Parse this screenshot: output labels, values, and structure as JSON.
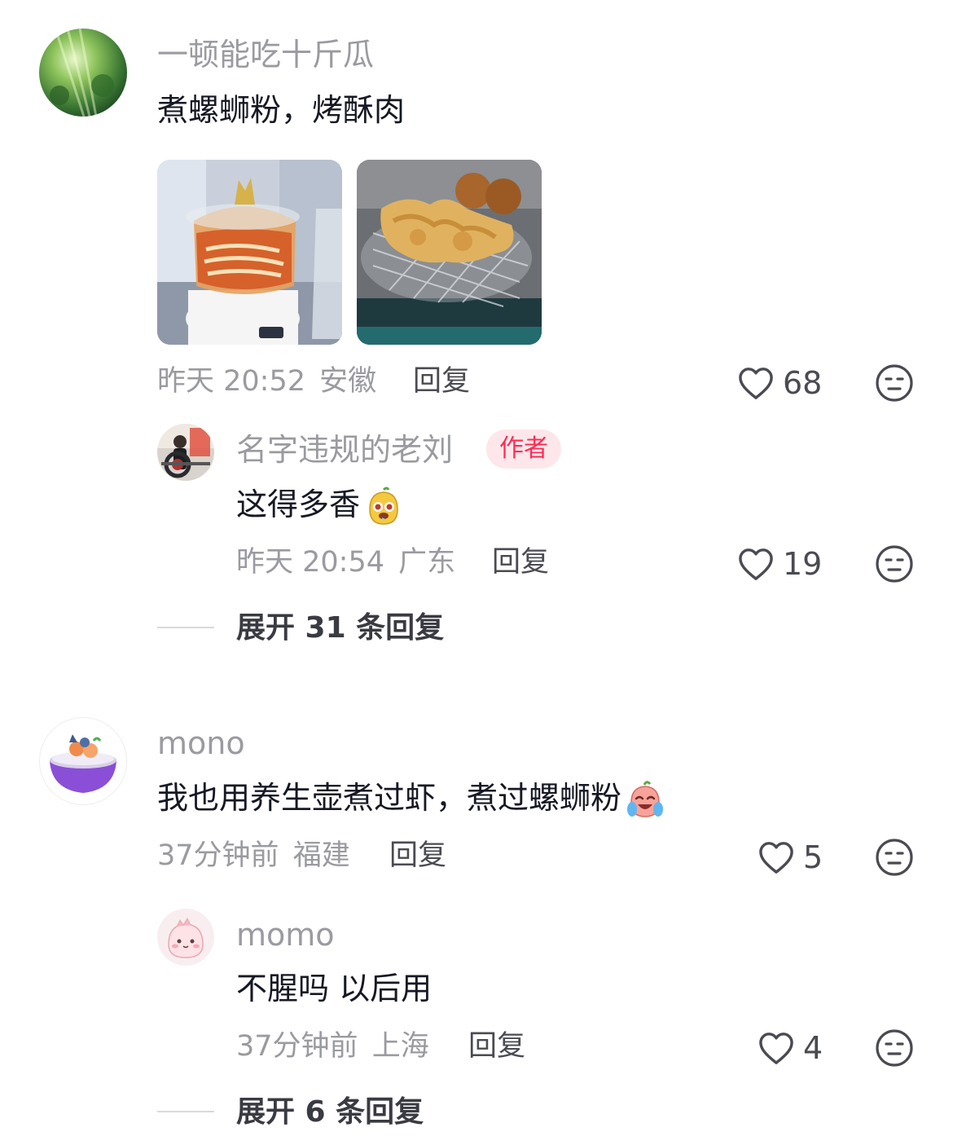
{
  "comments": [
    {
      "username": "一顿能吃十斤瓜",
      "text": "煮螺蛳粉，烤酥肉",
      "images": [
        "螺蛳粉照片",
        "酥肉照片"
      ],
      "time": "昨天 20:52",
      "location": "安徽",
      "reply_label": "回复",
      "likes": "68",
      "replies": [
        {
          "username": "名字违规的老刘",
          "badge": "作者",
          "text": "这得多香",
          "emoji": "drooling-face-emoji",
          "time": "昨天 20:54",
          "location": "广东",
          "reply_label": "回复",
          "likes": "19"
        }
      ],
      "expand_label": "展开 31 条回复"
    },
    {
      "username": "mono",
      "text": "我也用养生壶煮过虾，煮过螺蛳粉",
      "emoji": "crying-laughing-emoji",
      "time": "37分钟前",
      "location": "福建",
      "reply_label": "回复",
      "likes": "5",
      "replies": [
        {
          "username": "momo",
          "text": "不腥吗 以后用",
          "time": "37分钟前",
          "location": "上海",
          "reply_label": "回复",
          "likes": "4"
        }
      ],
      "expand_label": "展开 6 条回复"
    }
  ],
  "colors": {
    "primary_text": "#161823",
    "secondary_text": "#9a9ba0",
    "author_badge_bg": "#fde7ea",
    "author_badge_text": "#fe2c55"
  }
}
